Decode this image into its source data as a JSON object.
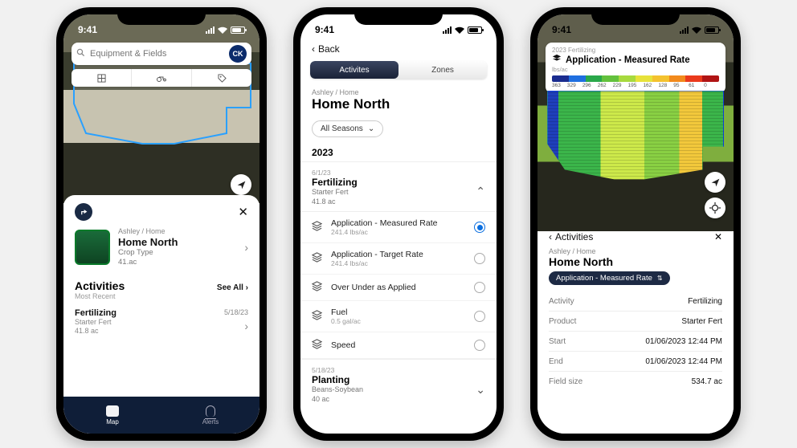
{
  "status": {
    "time": "9:41"
  },
  "phone1": {
    "search": {
      "placeholder": "Equipment & Fields",
      "avatar": "CK"
    },
    "card": {
      "breadcrumb": "Ashley / Home",
      "name": "Home North",
      "cropLabel": "Crop Type",
      "area": "41.ac"
    },
    "activities": {
      "heading": "Activities",
      "seeAll": "See All",
      "most": "Most Recent",
      "item": {
        "title": "Fertilizing",
        "sub": "Starter Fert",
        "area": "41.8 ac",
        "date": "5/18/23"
      }
    },
    "tabs": {
      "map": "Map",
      "alerts": "Alerts"
    }
  },
  "phone2": {
    "back": "Back",
    "seg": {
      "a": "Activites",
      "b": "Zones"
    },
    "breadcrumb": "Ashley / Home",
    "title": "Home North",
    "seasons": "All Seasons",
    "year": "2023",
    "group1": {
      "date": "6/1/23",
      "name": "Fertilizing",
      "sub": "Starter Fert",
      "area": "41.8 ac"
    },
    "layers": [
      {
        "name": "Application - Measured Rate",
        "val": "241.4 lbs/ac",
        "selected": true
      },
      {
        "name": "Application - Target Rate",
        "val": "241.4 lbs/ac",
        "selected": false
      },
      {
        "name": "Over Under as Applied",
        "val": "",
        "selected": false
      },
      {
        "name": "Fuel",
        "val": "0.5 gal/ac",
        "selected": false
      },
      {
        "name": "Speed",
        "val": "",
        "selected": false
      }
    ],
    "group2": {
      "date": "5/18/23",
      "name": "Planting",
      "sub": "Beans-Soybean",
      "area": "40 ac"
    }
  },
  "phone3": {
    "legend": {
      "season": "2023 Fertilizing",
      "title": "Application - Measured Rate",
      "unit": "lbs/ac",
      "colors": [
        "#1a2c8f",
        "#1f6fe0",
        "#2aa84a",
        "#63c13d",
        "#a7da3e",
        "#e7e23a",
        "#f4c22f",
        "#f28a1c",
        "#ea3a1c",
        "#b01414"
      ],
      "values": [
        "363",
        "329",
        "296",
        "262",
        "229",
        "195",
        "162",
        "128",
        "95",
        "61",
        "0"
      ]
    },
    "sheet": {
      "back": "Activities",
      "breadcrumb": "Ashley / Home",
      "title": "Home North",
      "chip": "Application - Measured Rate",
      "rows": [
        {
          "k": "Activity",
          "v": "Fertilizing"
        },
        {
          "k": "Product",
          "v": "Starter Fert"
        },
        {
          "k": "Start",
          "v": "01/06/2023 12:44 PM"
        },
        {
          "k": "End",
          "v": "01/06/2023 12:44 PM"
        },
        {
          "k": "Field size",
          "v": "534.7 ac"
        }
      ]
    }
  }
}
